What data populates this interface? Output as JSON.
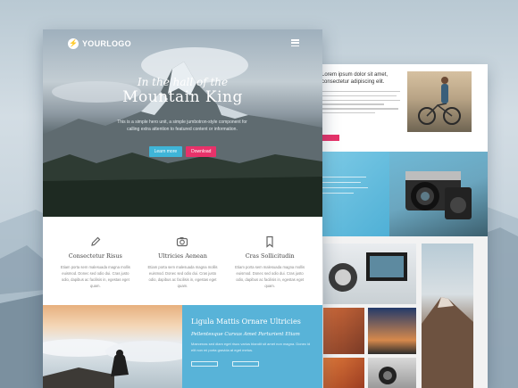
{
  "logo": {
    "text": "YOURLOGO",
    "icon": "bolt-icon"
  },
  "hero": {
    "subtitle": "In the hall of the",
    "title": "Mountain King",
    "body": "This is a simple hero unit, a simple jumbotron-style component for calling extra attention to featured content or information.",
    "buttons": [
      {
        "label": "Learn more",
        "color": "#3fb5d8"
      },
      {
        "label": "Download",
        "color": "#e8326a"
      }
    ]
  },
  "features": [
    {
      "icon": "pencil-icon",
      "title": "Consectetur Risus",
      "body": "Etiam porta sem malesuada magna mollis euismod. Donec sed odio dui. Cras justo odio, dapibus ac facilisis in, egestas eget quam."
    },
    {
      "icon": "camera-icon",
      "title": "Ultricies Aenean",
      "body": "Etiam porta sem malesuada magna mollis euismod. Donec sed odio dui. Cras justo odio, dapibus ac facilisis in, egestas eget quam."
    },
    {
      "icon": "bookmark-icon",
      "title": "Cras Sollicitudin",
      "body": "Etiam porta sem malesuada magna mollis euismod. Donec sed odio dui. Cras justo odio, dapibus ac facilisis in, egestas eget quam."
    }
  ],
  "panel": {
    "title": "Ligula Mattis Ornare Ultricies",
    "subtitle": "Pellentesque Cursus Amet Parturient Etiam",
    "body": "Maecenas sed diam eget risus varius blandit sit amet non magna. Donec id elit non mi porta gravida at eget metus."
  },
  "second": {
    "title": "Lorem ipsum dolor sit amet, consectetur adipiscing elit."
  },
  "colors": {
    "accent_blue": "#58b3d8",
    "accent_pink": "#e8326a"
  }
}
